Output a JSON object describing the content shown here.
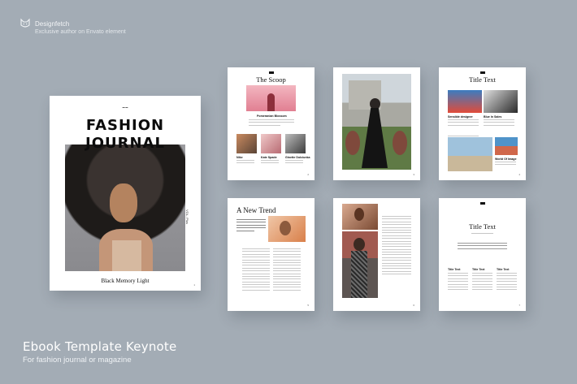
{
  "brand": {
    "name": "Designfetch",
    "tagline": "Exclusive author on Envato element",
    "icon": "cat-face-icon"
  },
  "product": {
    "title": "Ebook Template Keynote",
    "subtitle": "For fashion journal or magazine"
  },
  "colors": {
    "background": "#a3acb5",
    "page": "#ffffff",
    "text": "#111111"
  },
  "cover": {
    "title_line1": "FASHION",
    "title_line2": "JOURNAL",
    "footer": "Black Memory Light",
    "side_label": "VOL. Plus"
  },
  "pages": {
    "scoop": {
      "title": "The Scoop",
      "feature": "Pomeranian Blossom",
      "cap1": "Nike",
      "cap2": "Kate Spade",
      "cap3": "Ginette Dolciunka"
    },
    "trend": {
      "title": "A New Trend"
    },
    "title_text_grid": {
      "title": "Title Text",
      "cap1": "Sensible designer",
      "cap2": "Blue In Sales",
      "cap3": "World Of Image"
    },
    "title_text_cols": {
      "title": "Title Text",
      "col1": "Title Text",
      "col2": "Title Text",
      "col3": "Title Text"
    }
  }
}
